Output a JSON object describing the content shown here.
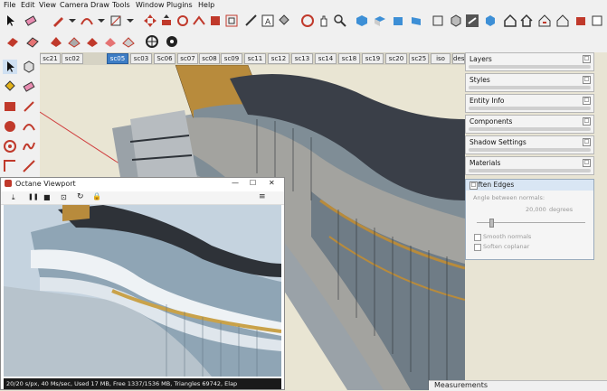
{
  "menubar": {
    "items": [
      "File",
      "Edit",
      "View",
      "Camera",
      "Draw",
      "Tools",
      "Window",
      "Plugins",
      "Help"
    ]
  },
  "scene_tabs": [
    "sc21",
    "sc02",
    "sc05",
    "sc03",
    "Sc06",
    "sc07",
    "sc08",
    "sc09",
    "sc11",
    "sc12",
    "sc13",
    "sc14",
    "sc18",
    "sc19",
    "sc20",
    "sc25",
    "iso",
    "des"
  ],
  "active_scene": "sc05",
  "tray": {
    "panels": [
      "Layers",
      "Styles",
      "Entity Info",
      "Components",
      "Shadow Settings",
      "Materials"
    ],
    "collapse_glyph": "□",
    "soften": {
      "title": "Soften Edges",
      "angle_label": "Angle between normals:",
      "angle_value": "20,000",
      "angle_unit": "degrees",
      "smooth_normals": "Smooth normals",
      "soften_coplanar": "Soften coplanar"
    }
  },
  "octane": {
    "title": "Octane Viewport",
    "status": "20/20 s/px, 40 Ms/sec, Used 17 MB, Free 1337/1536 MB, Triangles 69742, Elap",
    "window_controls": [
      "—",
      "☐",
      "✕"
    ],
    "toolbar_glyphs": [
      "⤓",
      "❚❚",
      "■",
      "⊡",
      "↻",
      "🔒",
      "≡"
    ]
  },
  "status": {
    "measurements_label": "Measurements"
  },
  "colors": {
    "sky": "#e8e4d4",
    "roof": "#3a3f48",
    "glass": "#8a9ba8",
    "gold": "#b08a3a",
    "active_tab": "#3d7dc5",
    "octane_sky": "#c8d6e2"
  }
}
